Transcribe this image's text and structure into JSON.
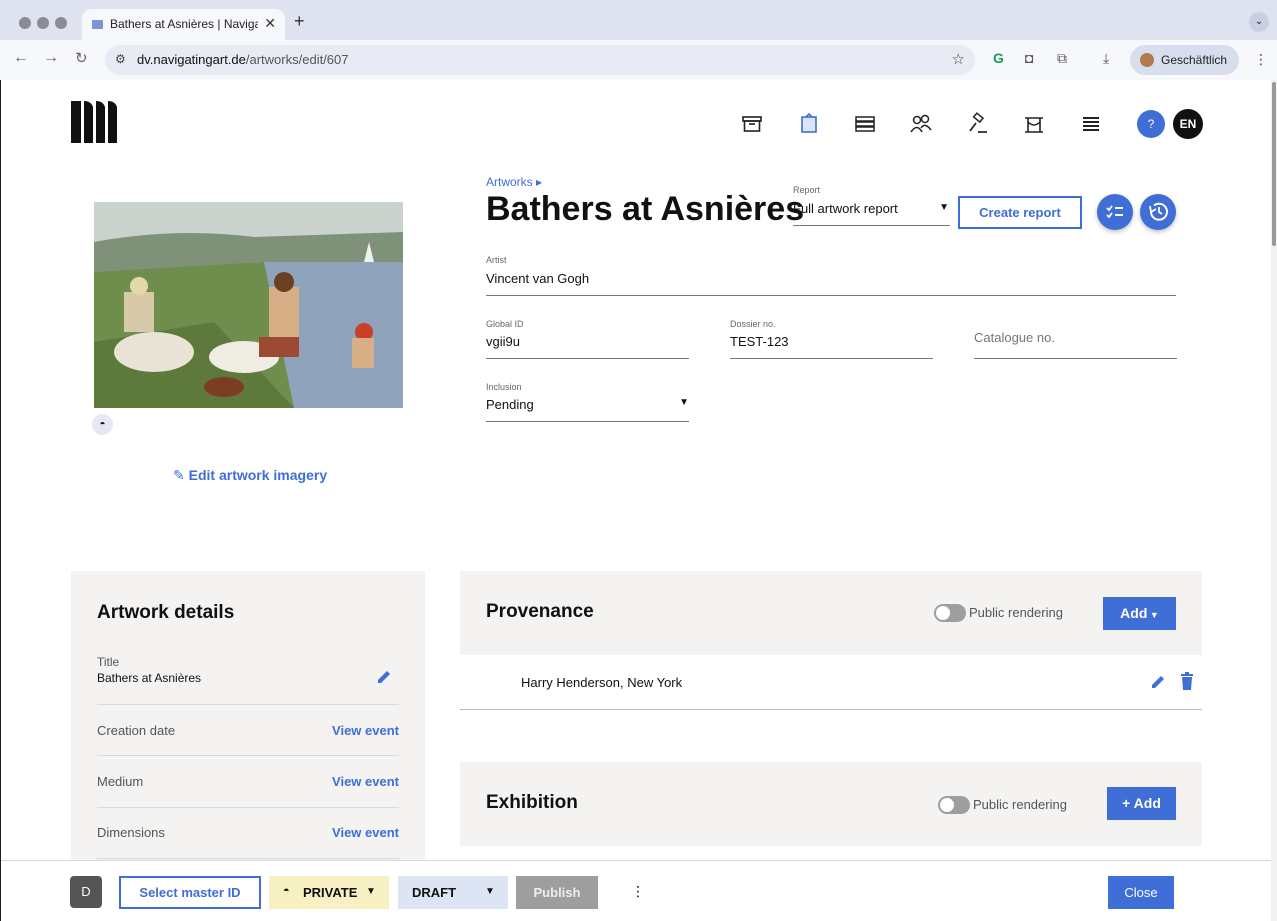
{
  "browser": {
    "tab_title": "Bathers at Asnières | Navigati",
    "tab_close": "✕",
    "new_tab": "+",
    "tab_menu": "⌄",
    "url_host": "dv.navigatingart.de",
    "url_path": "/artworks/edit/607",
    "profile_name": "Geschäftlich"
  },
  "header": {
    "help_label": "?",
    "lang_label": "EN",
    "nav_icons": [
      "archive-icon",
      "artwork-icon",
      "collection-icon",
      "people-icon",
      "auction-icon",
      "exhibition-icon",
      "list-icon"
    ]
  },
  "artwork": {
    "breadcrumb": "Artworks ▸",
    "title": "Bathers at Asnières",
    "edit_imagery": "Edit artwork imagery"
  },
  "report": {
    "label": "Report",
    "selected": "Full artwork report",
    "create_label": "Create report"
  },
  "fields": {
    "artist_label": "Artist",
    "artist_value": "Vincent van Gogh",
    "global_id_label": "Global ID",
    "global_id_value": "vgii9u",
    "dossier_label": "Dossier no.",
    "dossier_value": "TEST-123",
    "catalogue_placeholder": "Catalogue no.",
    "inclusion_label": "Inclusion",
    "inclusion_value": "Pending"
  },
  "details": {
    "heading": "Artwork details",
    "title_label": "Title",
    "title_value": "Bathers at Asnières",
    "rows": [
      {
        "label": "Creation date",
        "action": "View event"
      },
      {
        "label": "Medium",
        "action": "View event"
      },
      {
        "label": "Dimensions",
        "action": "View event"
      }
    ]
  },
  "provenance": {
    "heading": "Provenance",
    "toggle_label": "Public rendering",
    "add_label": "Add",
    "entries": [
      "Harry Henderson, New York"
    ]
  },
  "exhibition": {
    "heading": "Exhibition",
    "toggle_label": "Public rendering",
    "add_label": "+ Add"
  },
  "bottom": {
    "avatar": "D",
    "select_master": "Select master ID",
    "private_label": "PRIVATE",
    "draft_label": "DRAFT",
    "publish_label": "Publish",
    "more_label": "⋮",
    "close_label": "Close"
  },
  "colors": {
    "accent": "#3f6ed6",
    "private_bg": "#f6f0c2",
    "draft_bg": "#dde5f4",
    "panel_bg": "#f4f3f1"
  }
}
